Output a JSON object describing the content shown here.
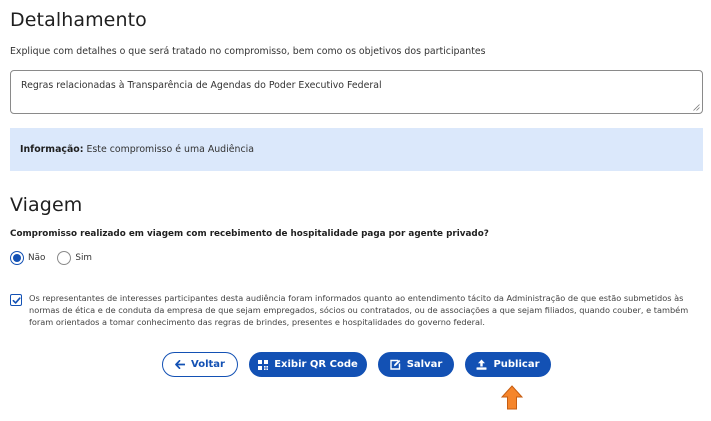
{
  "detalhamento": {
    "title": "Detalhamento",
    "description": "Explique com detalhes o que será tratado no compromisso, bem como os objetivos dos participantes",
    "textarea_value": "Regras relacionadas à Transparência de Agendas do Poder Executivo Federal"
  },
  "info": {
    "label": "Informação:",
    "text": " Este compromisso é uma Audiência"
  },
  "viagem": {
    "title": "Viagem",
    "question": "Compromisso realizado em viagem com recebimento de hospitalidade paga por agente privado?",
    "options": [
      {
        "label": "Não",
        "checked": true
      },
      {
        "label": "Sim",
        "checked": false
      }
    ]
  },
  "declaration": {
    "checked": true,
    "text": "Os representantes de interesses participantes desta audiência foram informados quanto ao entendimento tácito da Administração de que estão submetidos às normas de ética e de conduta da empresa de que sejam empregados, sócios ou contratados, ou de associações a que sejam filiados, quando couber, e também foram orientados a tomar conhecimento das regras de brindes, presentes e hospitalidades do governo federal."
  },
  "buttons": {
    "voltar": "Voltar",
    "qr": "Exibir QR Code",
    "salvar": "Salvar",
    "publicar": "Publicar"
  },
  "colors": {
    "primary": "#1351b4",
    "info_bg": "#dbe8fb",
    "arrow": "#f5852b"
  }
}
